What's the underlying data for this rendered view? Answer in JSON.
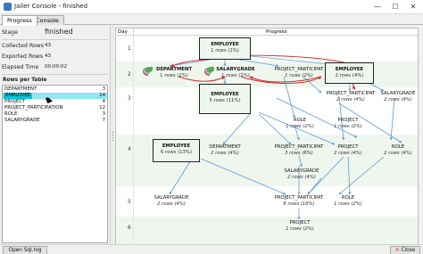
{
  "window": {
    "title": "Jailer Console - finished",
    "icon": "app-icon",
    "controls": {
      "minimize": "—",
      "maximize": "☐",
      "close": "✕"
    }
  },
  "tabs": [
    {
      "label": "Progress",
      "active": true
    },
    {
      "label": "Console",
      "active": false
    }
  ],
  "stats": {
    "stage_label": "Stage",
    "stage_value": "finished",
    "collected_label": "Collected Rows",
    "collected_value": "43",
    "exported_label": "Exported Rows",
    "exported_value": "43",
    "elapsed_label": "Elapsed Time",
    "elapsed_value": "00:00:02"
  },
  "rows_per_table": {
    "title": "Rows per Table",
    "rows": [
      {
        "name": "DEPARTMENT",
        "count": "3"
      },
      {
        "name": "EMPLOYEE",
        "count": "14",
        "selected": true
      },
      {
        "name": "PROJECT",
        "count": "4"
      },
      {
        "name": "PROJECT_PARTICIPATION",
        "count": "12"
      },
      {
        "name": "ROLE",
        "count": "3"
      },
      {
        "name": "SALARYGRADE",
        "count": "7"
      }
    ]
  },
  "graph": {
    "header_day": "Day",
    "header_progress": "Progress",
    "days": [
      "1",
      "2",
      "3",
      "4",
      "5",
      "6"
    ],
    "nodes": {
      "n1": {
        "name": "EMPLOYEE",
        "rows": "1 rows (2%)"
      },
      "n2": {
        "name": "DEPARTMENT",
        "rows": "1 rows (2%)"
      },
      "n3": {
        "name": "SALARYGRADE",
        "rows": "1 rows (2%)"
      },
      "n4": {
        "name": "PROJECT_PARTICIPAT",
        "rows": "1 rows (2%)"
      },
      "n5": {
        "name": "EMPLOYEE",
        "rows": "2 rows (4%)"
      },
      "n6": {
        "name": "EMPLOYEE",
        "rows": "5 rows (11%)"
      },
      "n7": {
        "name": "PROJECT_PARTICIPAT",
        "rows": "2 rows (4%)"
      },
      "n8": {
        "name": "SALARYGRADE",
        "rows": "2 rows (4%)"
      },
      "n9": {
        "name": "ROLE",
        "rows": "1 rows (2%)"
      },
      "n10": {
        "name": "PROJECT",
        "rows": "1 rows (2%)"
      },
      "n11": {
        "name": "EMPLOYEE",
        "rows": "6 rows (13%)"
      },
      "n12": {
        "name": "DEPARTMENT",
        "rows": "2 rows (4%)"
      },
      "n13": {
        "name": "PROJECT_PARTICIPAT",
        "rows": "3 rows (6%)"
      },
      "n14": {
        "name": "PROJECT",
        "rows": "2 rows (4%)"
      },
      "n15": {
        "name": "ROLE",
        "rows": "2 rows (4%)"
      },
      "n16": {
        "name": "SALARYGRADE",
        "rows": "2 rows (4%)"
      },
      "n17": {
        "name": "SALARYGRADE",
        "rows": "2 rows (4%)"
      },
      "n18": {
        "name": "PROJECT_PARTICIPAT",
        "rows": "8 rows (18%)"
      },
      "n19": {
        "name": "ROLE",
        "rows": "1 rows (2%)"
      },
      "n20": {
        "name": "PROJECT",
        "rows": "1 rows (2%)"
      }
    },
    "colors": {
      "edge_blue": "#5b9bd5",
      "edge_red": "#d32f2f",
      "band_alt": "#eef6ee"
    }
  },
  "footer": {
    "open_log": "Open Sql.log",
    "close": "Close",
    "close_icon": "close-icon"
  }
}
